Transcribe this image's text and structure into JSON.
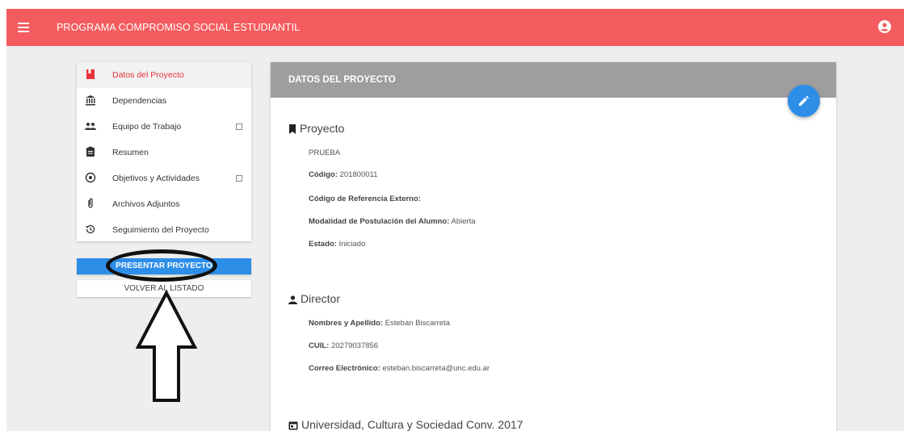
{
  "topbar": {
    "title": "PROGRAMA COMPROMISO SOCIAL ESTUDIANTIL",
    "menu_icon": "hamburger-icon",
    "user_icon": "account-icon",
    "color": "#f45b5e"
  },
  "sidebar": {
    "items": [
      {
        "label": "Datos del Proyecto",
        "icon": "bookmark-icon",
        "active": true
      },
      {
        "label": "Dependencias",
        "icon": "bank-icon"
      },
      {
        "label": "Equipo de Trabajo",
        "icon": "group-icon",
        "checkbox": true
      },
      {
        "label": "Resumen",
        "icon": "clipboard-icon"
      },
      {
        "label": "Objetivos y Actividades",
        "icon": "target-icon",
        "checkbox": true
      },
      {
        "label": "Archivos Adjuntos",
        "icon": "paperclip-icon"
      },
      {
        "label": "Seguimiento del Proyecto",
        "icon": "history-icon"
      }
    ],
    "present_button": "PRESENTAR PROYECTO",
    "back_button": "VOLVER AL LISTADO",
    "active_color": "#e8333a",
    "button_color": "#2d8ee8"
  },
  "main": {
    "header_title": "DATOS DEL PROYECTO",
    "edit_icon": "pencil-icon",
    "proyecto": {
      "title": "Proyecto",
      "name": "PRUEBA",
      "codigo_label": "Código:",
      "codigo_value": "201800011",
      "ref_label": "Código de Referencia Externo:",
      "ref_value": "",
      "modalidad_label": "Modalidad de Postulación del Alumno:",
      "modalidad_value": "Abierta",
      "estado_label": "Estado:",
      "estado_value": "Iniciado"
    },
    "director": {
      "title": "Director",
      "nombre_label": "Nombres y Apellido:",
      "nombre_value": "Esteban Biscarreta",
      "cuil_label": "CUIL:",
      "cuil_value": "20279037856",
      "email_label": "Correo Electrónico:",
      "email_value": "esteban.biscarreta@unc.edu.ar"
    },
    "convocatoria": {
      "title": "Universidad, Cultura y Sociedad Conv. 2017"
    }
  }
}
